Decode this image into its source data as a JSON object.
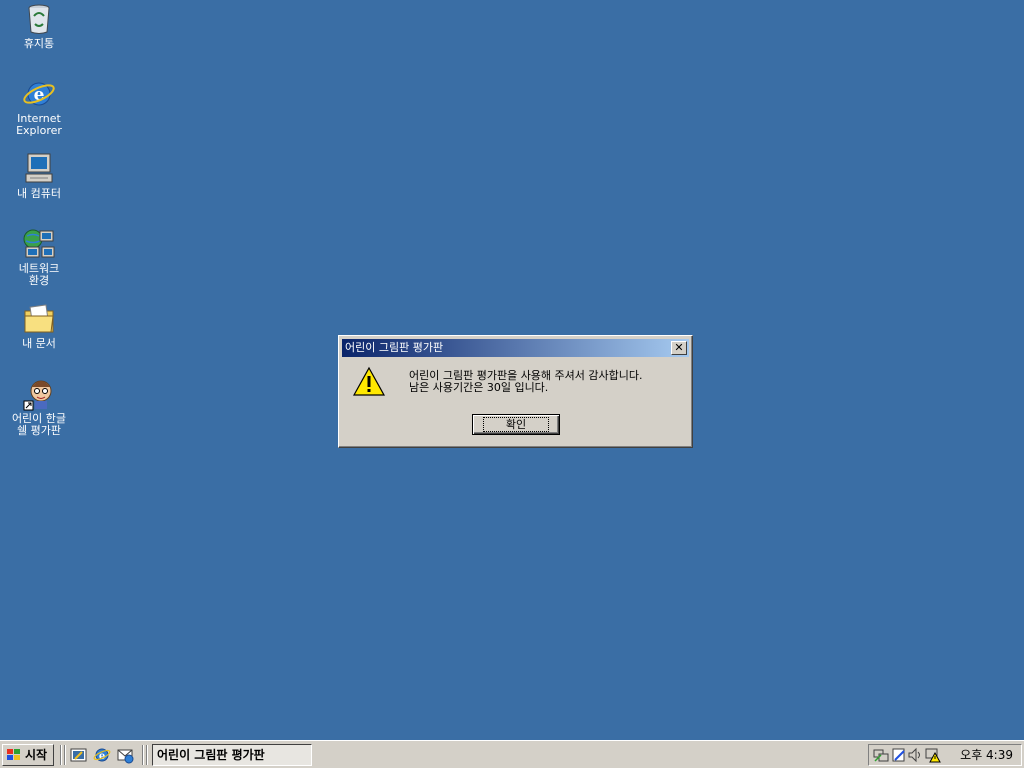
{
  "desktop": {
    "icons": [
      {
        "label": "휴지통"
      },
      {
        "label": "Internet\nExplorer"
      },
      {
        "label": "내 컴퓨터"
      },
      {
        "label": "네트워크\n환경"
      },
      {
        "label": "내 문서"
      },
      {
        "label": "어린이 한글\n쉘 평가판"
      }
    ]
  },
  "dialog": {
    "title": "어린이 그림판 평가판",
    "message_line1": "어린이 그림판 평가판을 사용해 주셔서 감사합니다.",
    "message_line2": "남은 사용기간은 30일 입니다.",
    "ok_label": "확인",
    "close_symbol": "✕",
    "icon": "warning-icon"
  },
  "taskbar": {
    "start_label": "시작",
    "active_task": "어린이 그림판 평가판",
    "clock": "오후 4:39"
  },
  "colors": {
    "desktop_bg": "#3a6ea5",
    "window_face": "#d4d0c8",
    "title_active": "#0a246a"
  }
}
